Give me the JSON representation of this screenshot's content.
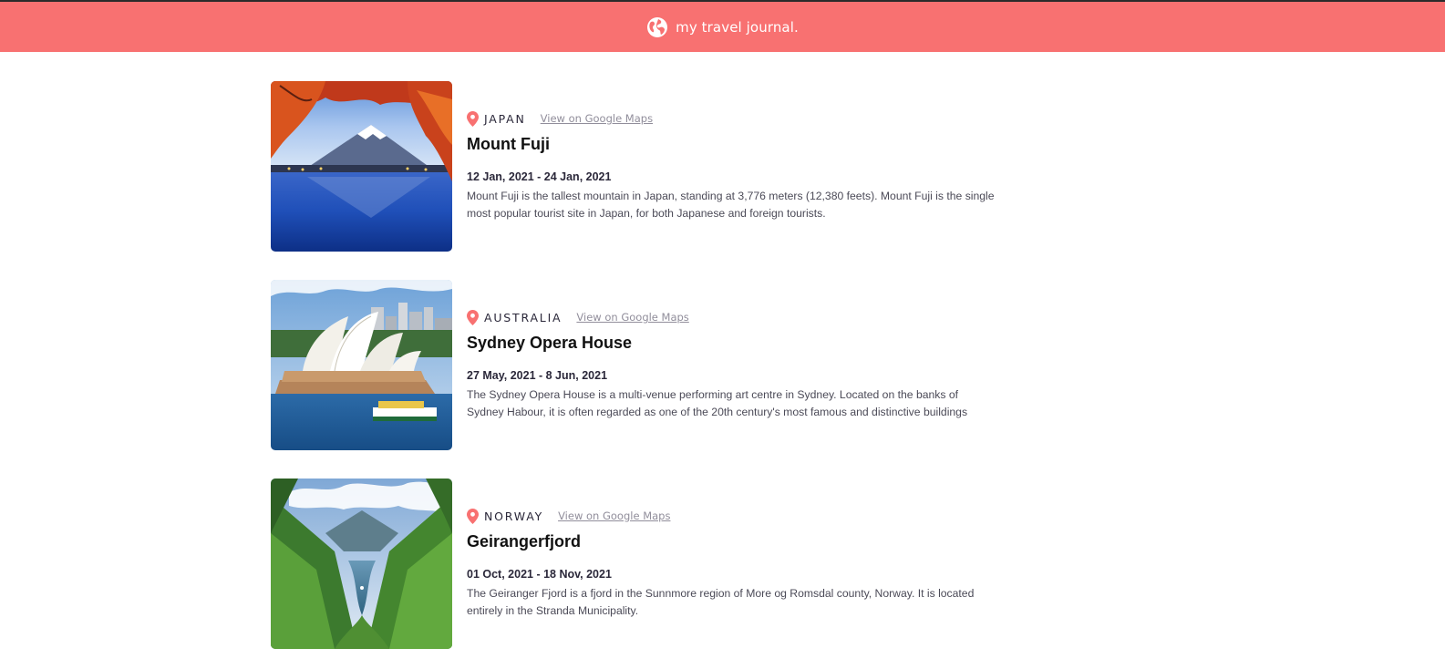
{
  "header": {
    "title": "my travel journal.",
    "icon": "globe-icon",
    "background": "#F87171"
  },
  "entries": [
    {
      "country": "JAPAN",
      "maps_label": "View on Google Maps",
      "place": "Mount Fuji",
      "dates": "12 Jan, 2021 - 24 Jan, 2021",
      "description": "Mount Fuji is the tallest mountain in Japan, standing at 3,776 meters (12,380 feets). Mount Fuji is the single most popular tourist site in Japan, for both Japanese and foreign tourists."
    },
    {
      "country": "AUSTRALIA",
      "maps_label": "View on Google Maps",
      "place": "Sydney Opera House",
      "dates": "27 May, 2021 - 8 Jun, 2021",
      "description": "The Sydney Opera House is a multi-venue performing art centre in Sydney. Located on the banks of Sydney Habour, it is often regarded as one of the 20th century's most famous and distinctive buildings"
    },
    {
      "country": "NORWAY",
      "maps_label": "View on Google Maps",
      "place": "Geirangerfjord",
      "dates": "01 Oct, 2021 - 18 Nov, 2021",
      "description": "The Geiranger Fjord is a fjord in the Sunnmore region of More og Romsdal county, Norway. It is located entirely in the Stranda Municipality."
    }
  ],
  "colors": {
    "accent": "#F87171",
    "link": "#918E9B",
    "text_dark": "#2B283A"
  }
}
